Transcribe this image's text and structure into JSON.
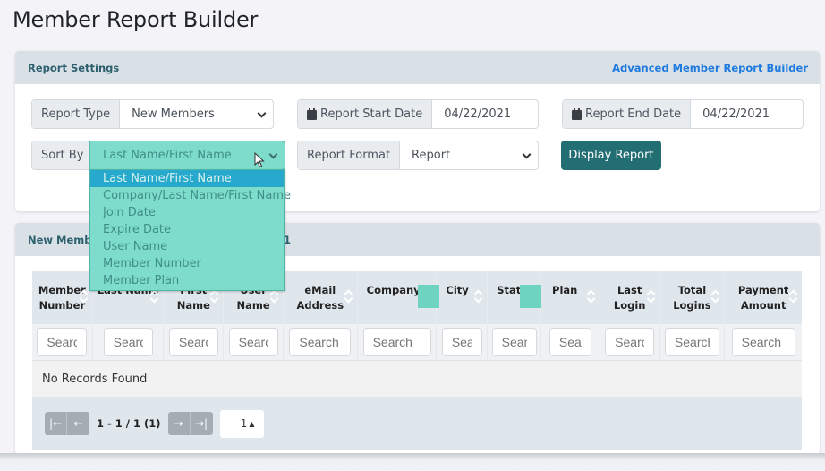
{
  "page": {
    "title": "Member Report Builder"
  },
  "settings": {
    "header": "Report Settings",
    "advanced_link": "Advanced Member Report Builder",
    "report_type": {
      "label": "Report Type",
      "value": "New Members"
    },
    "start_date": {
      "label": "Report Start Date",
      "value": "04/22/2021",
      "icon": "calendar-icon"
    },
    "end_date": {
      "label": "Report End Date",
      "value": "04/22/2021",
      "icon": "calendar-icon"
    },
    "sort_by": {
      "label": "Sort By",
      "value": "Last Name/First Name",
      "options": [
        "Last Name/First Name",
        "Company/Last Name/First Name",
        "Join Date",
        "Expire Date",
        "User Name",
        "Member Number",
        "Member Plan"
      ],
      "selected_index": 0
    },
    "report_format": {
      "label": "Report Format",
      "value": "Report"
    },
    "display_button": "Display Report"
  },
  "results": {
    "header_visible_start": "New Membe",
    "header_visible_end": "1",
    "columns": [
      {
        "label": "Member Number",
        "search_placeholder": "Search"
      },
      {
        "label": "Last Name",
        "search_placeholder": "Search"
      },
      {
        "label": "First Name",
        "search_placeholder": "Search"
      },
      {
        "label": "User Name",
        "search_placeholder": "Search"
      },
      {
        "label": "eMail Address",
        "search_placeholder": "Search"
      },
      {
        "label": "Company",
        "search_placeholder": "Search"
      },
      {
        "label": "City",
        "search_placeholder": "Search"
      },
      {
        "label": "State",
        "search_placeholder": "Search"
      },
      {
        "label": "Plan",
        "search_placeholder": "Search"
      },
      {
        "label": "Last Login",
        "search_placeholder": "Search"
      },
      {
        "label": "Total Logins",
        "search_placeholder": "Search"
      },
      {
        "label": "Payment Amount",
        "search_placeholder": "Search"
      }
    ],
    "empty_message": "No Records Found",
    "pagination": {
      "info": "1 - 1 / 1 (1)",
      "page_select": "1",
      "first_icon": "first-page-icon",
      "prev_icon": "arrow-left-icon",
      "next_icon": "arrow-right-icon",
      "last_icon": "last-page-icon"
    }
  },
  "colors": {
    "primary_button": "#236e73",
    "header_bg": "#d9e1e7",
    "link": "#1f7adf",
    "dropdown_highlight": "#26a9cc",
    "dropdown_bg": "#7ddccb"
  }
}
